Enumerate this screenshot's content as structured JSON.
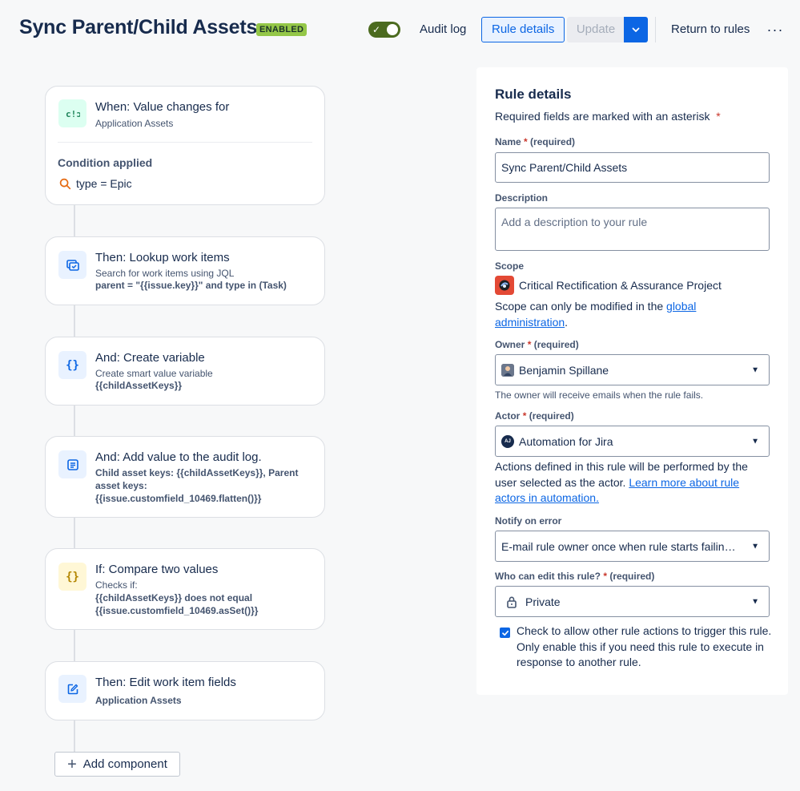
{
  "header": {
    "title": "Sync Parent/Child Assets",
    "status_badge": "ENABLED",
    "audit_log_label": "Audit log",
    "rule_details_label": "Rule details",
    "update_label": "Update",
    "return_label": "Return to rules",
    "more_label": "···"
  },
  "flow": {
    "trigger": {
      "title": "When: Value changes for",
      "subtitle": "Application Assets",
      "condition_label": "Condition applied",
      "condition": "type = Epic"
    },
    "steps": [
      {
        "title": "Then: Lookup work items",
        "line1": "Search for work items using JQL",
        "line2": "parent = \"{{issue.key}}\" and type in (Task)"
      },
      {
        "title": "And: Create variable",
        "line1": "Create smart value variable",
        "line2": "{{childAssetKeys}}"
      },
      {
        "title": "And: Add value to the audit log.",
        "line1": "Child asset keys: {{childAssetKeys}}, Parent asset keys: {{issue.customfield_10469.flatten()}}"
      },
      {
        "title": "If: Compare two values",
        "line1": "Checks if:",
        "line2": "{{childAssetKeys}} does not equal {{issue.customfield_10469.asSet()}}"
      },
      {
        "title": "Then: Edit work item fields",
        "line1": "Application Assets"
      }
    ],
    "add_component_label": "Add component"
  },
  "panel": {
    "title": "Rule details",
    "required_note": "Required fields are marked with an asterisk",
    "asterisk": "*",
    "name_label": "Name",
    "required_text": "(required)",
    "name_value": "Sync Parent/Child Assets",
    "description_label": "Description",
    "description_placeholder": "Add a description to your rule",
    "scope_label": "Scope",
    "scope_value": "Critical Rectification & Assurance Project",
    "scope_note": "Scope can only be modified in the",
    "scope_link": "global administration",
    "scope_note_end": ".",
    "owner_label": "Owner",
    "owner_value": "Benjamin Spillane",
    "owner_helper": "The owner will receive emails when the rule fails.",
    "actor_label": "Actor",
    "actor_value": "Automation for Jira",
    "actor_avatar_text": "AJ",
    "actor_note": "Actions defined in this rule will be performed by the user selected as the actor.",
    "actor_link": "Learn more about rule actors in automation.",
    "notify_label": "Notify on error",
    "notify_value": "E-mail rule owner once when rule starts failing after success",
    "edit_label": "Who can edit this rule?",
    "edit_value": "Private",
    "trigger_checkbox_checked": true,
    "trigger_checkbox_text": "Check to allow other rule actions to trigger this rule. Only enable this if you need this rule to execute in response to another rule."
  },
  "colors": {
    "primary": "#0c66e4",
    "enabled_badge": "#94c748",
    "toggle_on": "#4c6b1f",
    "required_asterisk": "#c9372c"
  }
}
